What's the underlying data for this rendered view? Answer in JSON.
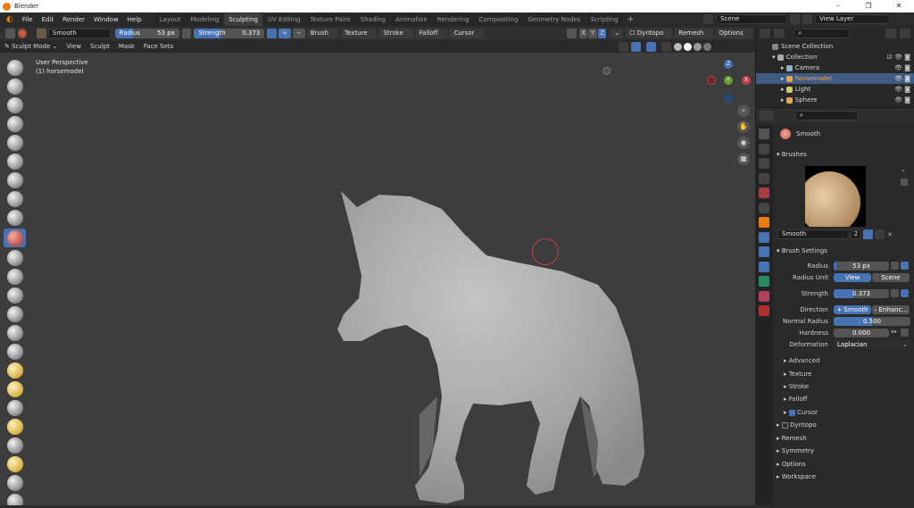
{
  "window": {
    "title": "Blender",
    "controls": [
      "–",
      "❐",
      "✕"
    ]
  },
  "menu": [
    "File",
    "Edit",
    "Render",
    "Window",
    "Help"
  ],
  "workspaces": [
    "Layout",
    "Modeling",
    "Sculpting",
    "UV Editing",
    "Texture Paint",
    "Shading",
    "Animation",
    "Rendering",
    "Compositing",
    "Geometry Nodes",
    "Scripting"
  ],
  "active_workspace": "Sculpting",
  "scene": {
    "scene_name": "Scene",
    "view_layer": "View Layer"
  },
  "tool_header": {
    "brush_name": "Smooth",
    "radius_label": "Radius",
    "radius_value": "53 px",
    "strength_label": "Strength",
    "strength_value": "0.373",
    "strength_fraction": 0.373,
    "plus": "+",
    "minus": "−",
    "dropdowns": [
      "Brush",
      "Texture",
      "Stroke",
      "Falloff",
      "Cursor"
    ],
    "axes": [
      "X",
      "Y",
      "Z"
    ],
    "dyntopo": "Dyntopo",
    "remesh": "Remesh",
    "options": "Options"
  },
  "mode_header": {
    "mode": "Sculpt Mode",
    "items": [
      "View",
      "Sculpt",
      "Mask",
      "Face Sets"
    ]
  },
  "viewport": {
    "perspective": "User Perspective",
    "object": "(1) horsemodel",
    "gizmo_x": "X",
    "gizmo_y": "Y",
    "gizmo_z": "Z"
  },
  "outliner": {
    "root": "Scene Collection",
    "collection": "Collection",
    "items": [
      {
        "name": "Camera",
        "color": "#8ab4c9"
      },
      {
        "name": "horsemodel",
        "color": "#e8a54d",
        "selected": true
      },
      {
        "name": "Light",
        "color": "#cfcf60"
      },
      {
        "name": "Sphere",
        "color": "#e8a54d"
      }
    ]
  },
  "properties": {
    "brush_name": "Smooth",
    "brushes_panel": "Brushes",
    "brush_field": "Smooth",
    "brush_users": "2",
    "brush_settings": "Brush Settings",
    "radius_label": "Radius",
    "radius_value": "53 px",
    "radius_unit_label": "Radius Unit",
    "radius_unit_view": "View",
    "radius_unit_scene": "Scene",
    "strength_label": "Strength",
    "strength_value": "0.373",
    "strength_fraction": 0.373,
    "direction_label": "Direction",
    "direction_smooth": "+ Smooth",
    "direction_enhance": "– Enhanc...",
    "normal_radius_label": "Normal Radius",
    "normal_radius_value": "0.500",
    "normal_radius_fraction": 0.5,
    "hardness_label": "Hardness",
    "hardness_value": "0.000",
    "deformation_label": "Deformation",
    "deformation_value": "Laplacian",
    "subpanels": [
      "Advanced",
      "Texture",
      "Stroke",
      "Falloff",
      "Cursor"
    ],
    "main_panels": [
      "Dyntopo",
      "Remesh",
      "Symmetry",
      "Options",
      "Workspace"
    ]
  },
  "colors": {
    "accent": "#4772b3",
    "background": "#3d3d3d",
    "panel": "#2a2a2a"
  }
}
